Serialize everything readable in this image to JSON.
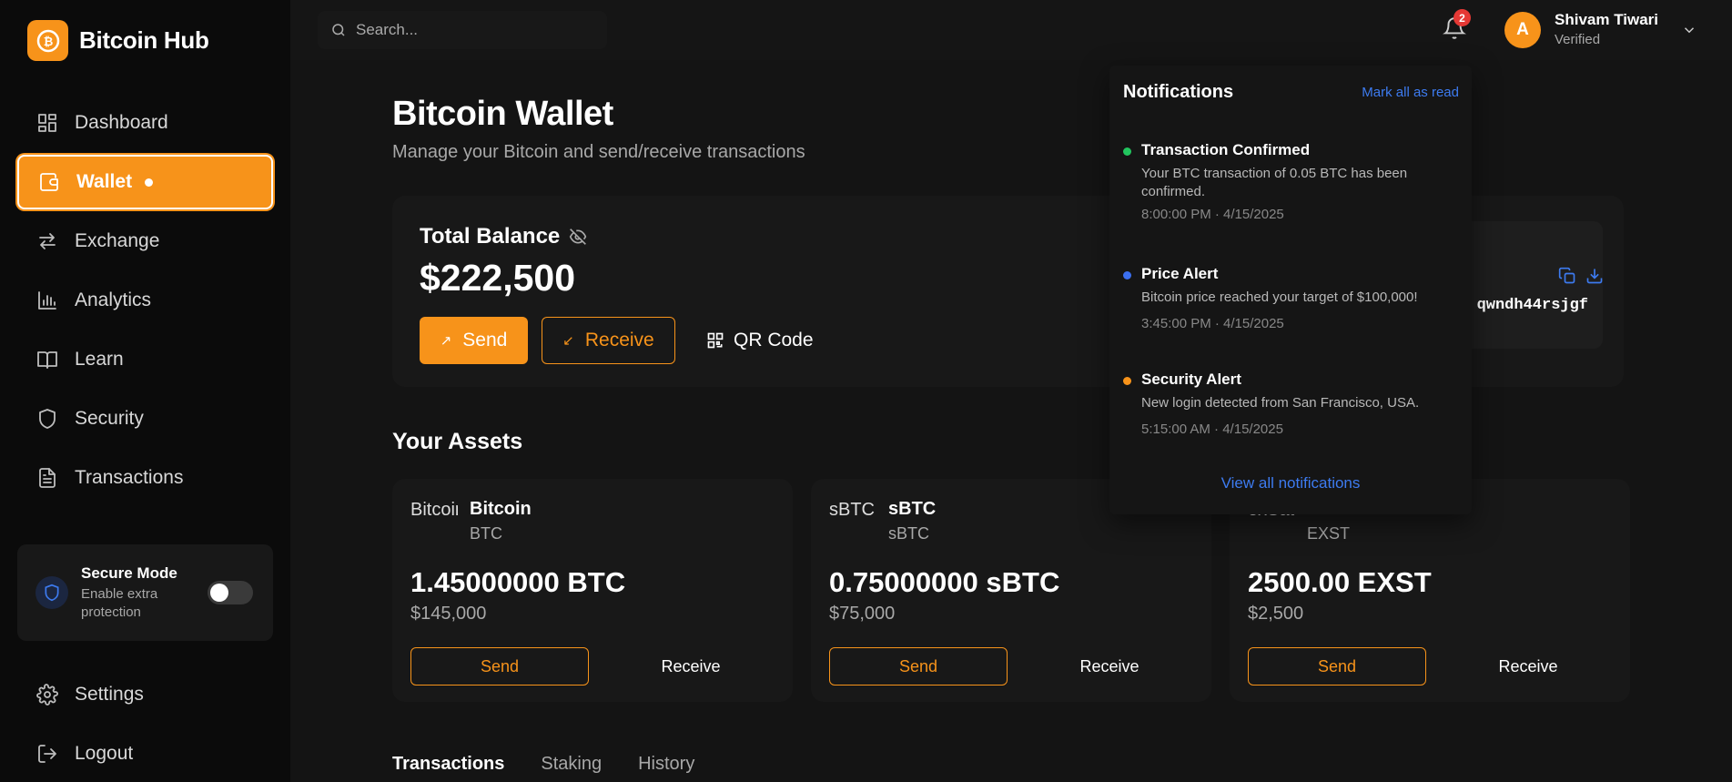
{
  "app": {
    "name": "Bitcoin Hub"
  },
  "sidebar": {
    "items": [
      {
        "label": "Dashboard",
        "icon": "dashboard-icon"
      },
      {
        "label": "Wallet",
        "icon": "wallet-icon",
        "active": true
      },
      {
        "label": "Exchange",
        "icon": "exchange-icon"
      },
      {
        "label": "Analytics",
        "icon": "analytics-icon"
      },
      {
        "label": "Learn",
        "icon": "book-icon"
      },
      {
        "label": "Security",
        "icon": "shield-icon"
      },
      {
        "label": "Transactions",
        "icon": "document-icon"
      }
    ],
    "secure_mode": {
      "title": "Secure Mode",
      "subtitle": "Enable extra protection",
      "enabled": false
    },
    "bottom_items": [
      {
        "label": "Settings",
        "icon": "gear-icon"
      },
      {
        "label": "Logout",
        "icon": "logout-icon"
      }
    ]
  },
  "topbar": {
    "search_placeholder": "Search...",
    "notification_count": "2",
    "user": {
      "initial": "A",
      "name": "Shivam Tiwari",
      "status": "Verified"
    }
  },
  "main": {
    "title": "Bitcoin Wallet",
    "subtitle": "Manage your Bitcoin and send/receive transactions",
    "balance": {
      "label": "Total Balance",
      "amount": "$222,500",
      "send_label": "Send",
      "receive_label": "Receive",
      "qr_label": "QR Code",
      "address_fragment": "qwndh44rsjgf"
    },
    "assets_title": "Your Assets",
    "assets": [
      {
        "img_alt": "Bitcoin",
        "name": "Bitcoin",
        "symbol": "BTC",
        "amount": "1.45000000 BTC",
        "usd": "$145,000",
        "send": "Send",
        "receive": "Receive"
      },
      {
        "img_alt": "sBTC",
        "name": "sBTC",
        "symbol": "sBTC",
        "amount": "0.75000000 sBTC",
        "usd": "$75,000",
        "send": "Send",
        "receive": "Receive"
      },
      {
        "img_alt": "exSat",
        "name": "exSat",
        "symbol": "EXST",
        "amount": "2500.00 EXST",
        "usd": "$2,500",
        "send": "Send",
        "receive": "Receive"
      }
    ],
    "tabs": [
      "Transactions",
      "Staking",
      "History"
    ]
  },
  "notifications": {
    "title": "Notifications",
    "mark_all": "Mark all as read",
    "items": [
      {
        "title": "Transaction Confirmed",
        "message": "Your BTC transaction of 0.05 BTC has been confirmed.",
        "time": "8:00:00 PM · 4/15/2025",
        "color": "#22c55e"
      },
      {
        "title": "Price Alert",
        "message": "Bitcoin price reached your target of $100,000!",
        "time": "3:45:00 PM · 4/15/2025",
        "color": "#3b6ff0"
      },
      {
        "title": "Security Alert",
        "message": "New login detected from San Francisco, USA.",
        "time": "5:15:00 AM · 4/15/2025",
        "color": "#f7931a"
      }
    ],
    "view_all": "View all notifications"
  },
  "colors": {
    "accent": "#f7931a",
    "link": "#3d7bf0",
    "background": "#141414"
  }
}
